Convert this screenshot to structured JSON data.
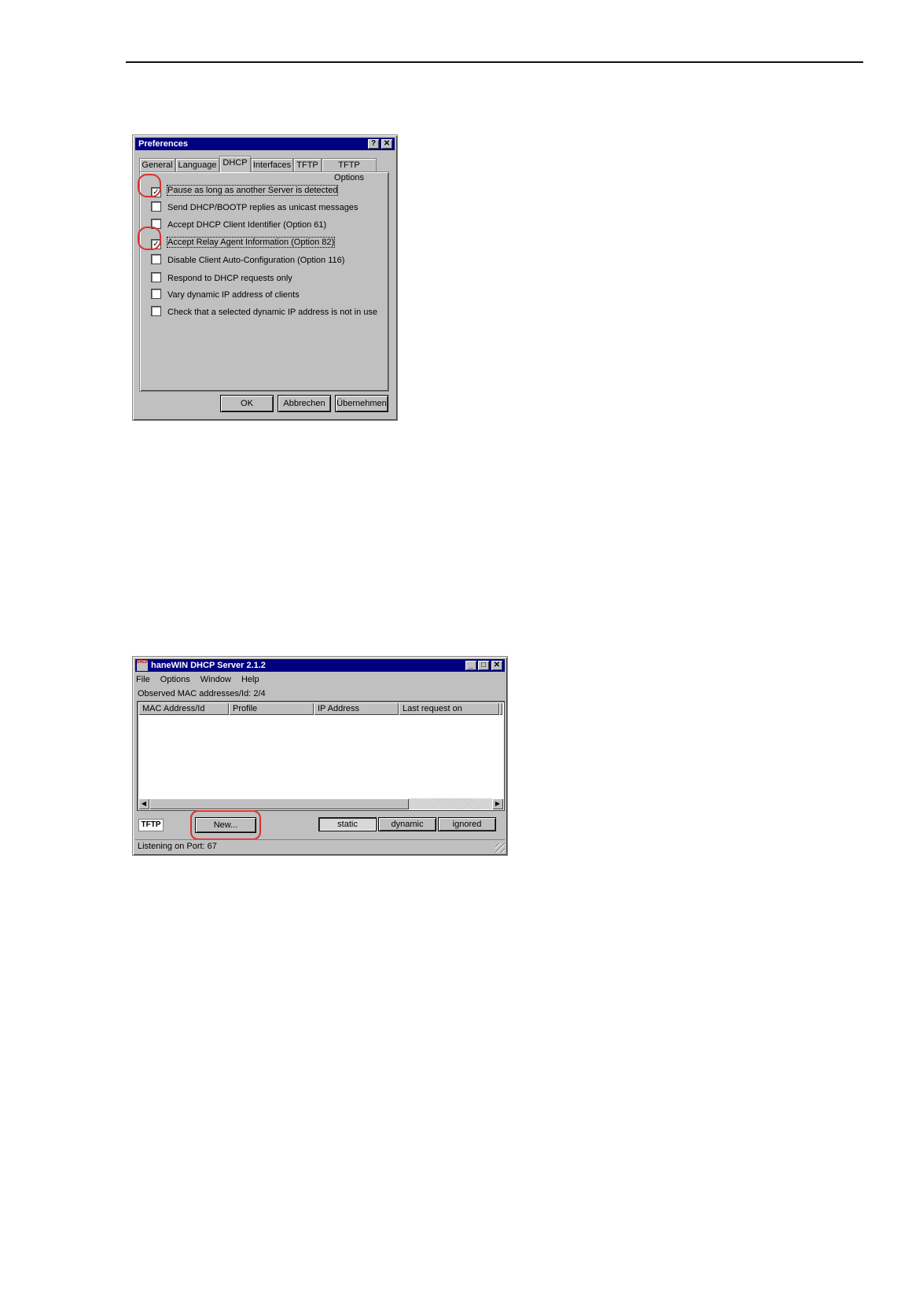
{
  "preferences": {
    "title": "Preferences",
    "help_btn": "?",
    "close_btn": "✕",
    "tabs": [
      "General",
      "Language",
      "DHCP",
      "Interfaces",
      "TFTP",
      "TFTP Options"
    ],
    "active_tab": "DHCP",
    "options": [
      {
        "label": "Pause as long as another Server is detected",
        "checked": true
      },
      {
        "label": "Send DHCP/BOOTP replies as unicast messages",
        "checked": false
      },
      {
        "label": "Accept DHCP Client Identifier (Option 61)",
        "checked": false
      },
      {
        "label": "Accept Relay Agent Information (Option 82)",
        "checked": true
      },
      {
        "label": "Disable Client Auto-Configuration (Option 116)",
        "checked": false
      },
      {
        "label": "Respond to DHCP requests only",
        "checked": false
      },
      {
        "label": "Vary dynamic IP address of clients",
        "checked": false
      },
      {
        "label": "Check that a selected dynamic IP address is not in use",
        "checked": false
      }
    ],
    "buttons": {
      "ok": "OK",
      "cancel": "Abbrechen",
      "apply": "Übernehmen"
    }
  },
  "dhcp_window": {
    "title": "haneWIN DHCP Server 2.1.2",
    "app_icon_text": "DHCP",
    "minimize": "_",
    "maximize": "□",
    "close": "✕",
    "menu": [
      "File",
      "Options",
      "Window",
      "Help"
    ],
    "observed_label": "Observed MAC addresses/Id:  2/4",
    "columns": [
      "MAC Address/Id",
      "Profile",
      "IP Address",
      "Last request on"
    ],
    "tftp_badge": "TFTP",
    "new_button": "New...",
    "filter_buttons": [
      "static",
      "dynamic",
      "ignored"
    ],
    "status": "Listening on Port: 67"
  },
  "colors": {
    "highlight": "#d9302c",
    "titlebar": "#000080",
    "face": "#c0c0c0"
  }
}
